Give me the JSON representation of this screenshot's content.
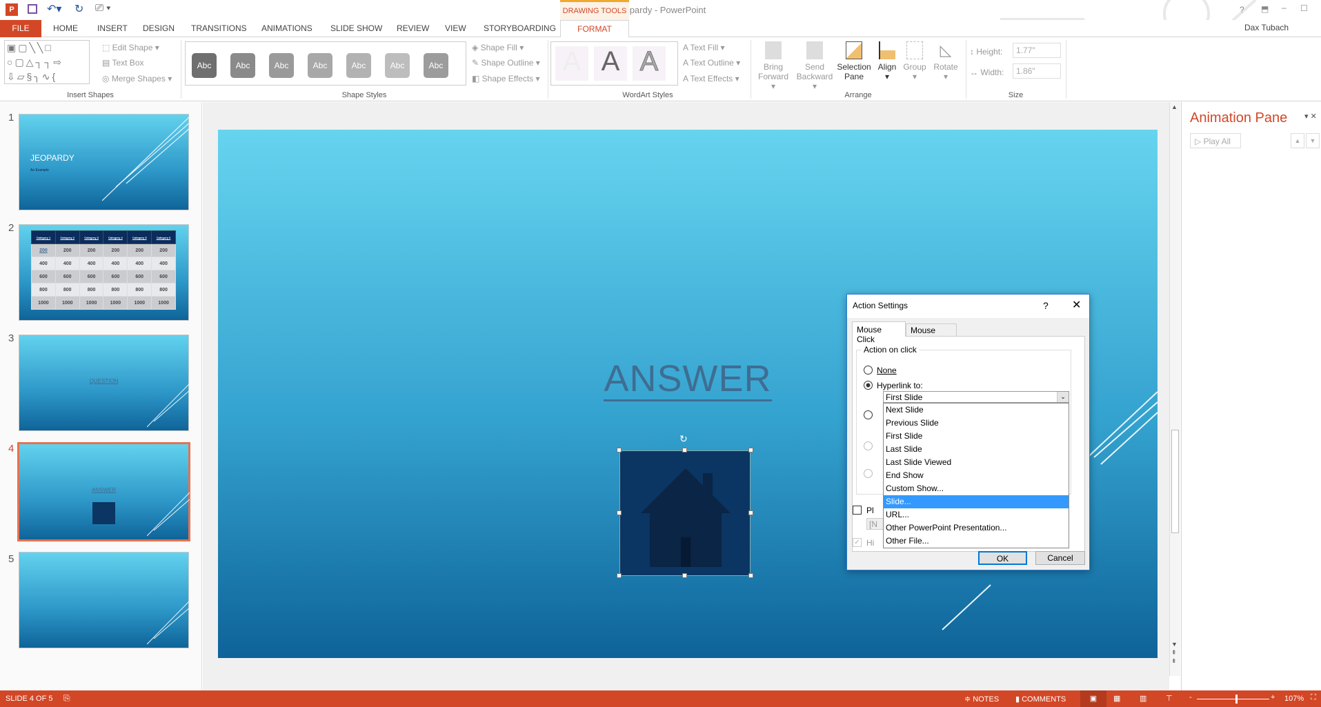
{
  "window": {
    "title": "Jeopardy - PowerPoint",
    "contextual_tab_group": "DRAWING TOOLS",
    "user": "Dax Tubach",
    "help": "?"
  },
  "tabs": [
    {
      "label": "FILE"
    },
    {
      "label": "HOME"
    },
    {
      "label": "INSERT"
    },
    {
      "label": "DESIGN"
    },
    {
      "label": "TRANSITIONS"
    },
    {
      "label": "ANIMATIONS"
    },
    {
      "label": "SLIDE SHOW"
    },
    {
      "label": "REVIEW"
    },
    {
      "label": "VIEW"
    },
    {
      "label": "STORYBOARDING"
    },
    {
      "label": "FORMAT",
      "active": true
    }
  ],
  "ribbon": {
    "insert_shapes": {
      "label": "Insert Shapes",
      "edit_shape": "Edit Shape",
      "text_box": "Text Box",
      "merge_shapes": "Merge Shapes"
    },
    "shape_styles": {
      "label": "Shape Styles",
      "swatch_text": "Abc",
      "swatches": [
        "#6f6f6f",
        "#8a8a8a",
        "#9a9a9a",
        "#a8a8a8",
        "#b2b2b2",
        "#bdbdbd",
        "#9c9c9c"
      ],
      "shape_fill": "Shape Fill",
      "shape_outline": "Shape Outline",
      "shape_effects": "Shape Effects"
    },
    "wordart": {
      "label": "WordArt Styles",
      "glyph": "A",
      "text_fill": "Text Fill",
      "text_outline": "Text Outline",
      "text_effects": "Text Effects"
    },
    "arrange": {
      "label": "Arrange",
      "bring_forward": [
        "Bring",
        "Forward"
      ],
      "send_backward": [
        "Send",
        "Backward"
      ],
      "selection_pane": [
        "Selection",
        "Pane"
      ],
      "align": "Align",
      "group": "Group",
      "rotate": "Rotate"
    },
    "size": {
      "label": "Size",
      "height_label": "Height:",
      "height_value": "1.77\"",
      "width_label": "Width:",
      "width_value": "1.86\""
    }
  },
  "thumbnails": [
    {
      "number": "1",
      "title": "JEOPARDY",
      "subtitle": "An Example"
    },
    {
      "number": "2",
      "headers": [
        "Category 1",
        "Category 2",
        "Category 3",
        "Category 4",
        "Category 5",
        "Category 6"
      ],
      "rows": [
        "200",
        "400",
        "600",
        "800",
        "1000"
      ]
    },
    {
      "number": "3",
      "title": "QUESTION"
    },
    {
      "number": "4",
      "title": "ANSWER",
      "selected": true
    },
    {
      "number": "5"
    }
  ],
  "slide": {
    "title": "ANSWER",
    "shape": "home-action-button"
  },
  "animation_pane": {
    "title": "Animation Pane",
    "play_all": "Play All"
  },
  "dialog": {
    "title": "Action Settings",
    "help": "?",
    "tabs": [
      "Mouse Click",
      "Mouse Over"
    ],
    "group_label": "Action on click",
    "none": "None",
    "hyperlink": "Hyperlink to:",
    "selected_value": "First Slide",
    "options": [
      "Next Slide",
      "Previous Slide",
      "First Slide",
      "Last Slide",
      "Last Slide Viewed",
      "End Show",
      "Custom Show...",
      "Slide...",
      "URL...",
      "Other PowerPoint Presentation...",
      "Other File..."
    ],
    "highlighted": "Slide...",
    "play_sound_partial": "Pl",
    "sound_partial": "[N",
    "highlight_partial": "Hi",
    "ok": "OK",
    "cancel": "Cancel"
  },
  "status": {
    "slide": "SLIDE 4 OF 5",
    "notes": "NOTES",
    "comments": "COMMENTS",
    "zoom": "107%",
    "zoom_percent": 107
  },
  "colors": {
    "accent": "#d24726",
    "selection": "#3399ff",
    "anim_title": "#d24726"
  }
}
